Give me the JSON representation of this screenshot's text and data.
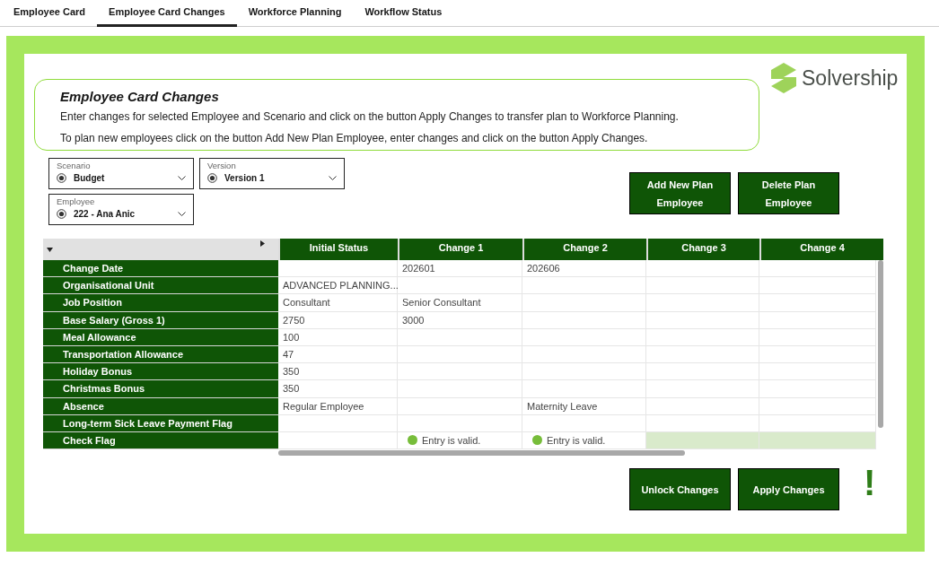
{
  "tabs": [
    {
      "label": "Employee Card",
      "selected": false
    },
    {
      "label": "Employee Card Changes",
      "selected": true
    },
    {
      "label": "Workforce Planning",
      "selected": false
    },
    {
      "label": "Workflow Status",
      "selected": false
    }
  ],
  "logo": {
    "name": "Solvership"
  },
  "intro": {
    "title": "Employee Card Changes",
    "lines": [
      "Enter changes for selected Employee and Scenario and click on the button Apply Changes to transfer plan to Workforce Planning.",
      "To plan new employees click on the button Add New Plan Employee, enter changes and click on the button Apply Changes."
    ]
  },
  "selectors": [
    {
      "label": "Scenario",
      "value": "Budget"
    },
    {
      "label": "Version",
      "value": "Version 1"
    },
    {
      "label": "Employee",
      "value": "222 - Ana Anic"
    }
  ],
  "top_buttons": [
    "Add New Plan Employee",
    "Delete Plan Employee"
  ],
  "table": {
    "columns": [
      "Initial Status",
      "Change 1",
      "Change 2",
      "Change 3",
      "Change 4"
    ],
    "rows": [
      {
        "label": "Change Date",
        "cells": [
          null,
          "202601",
          "202606",
          null,
          null
        ]
      },
      {
        "label": "Organisational Unit",
        "cells": [
          "ADVANCED PLANNING...",
          null,
          null,
          null,
          null
        ]
      },
      {
        "label": "Job Position",
        "cells": [
          "Consultant",
          "Senior Consultant",
          null,
          null,
          null
        ]
      },
      {
        "label": "Base Salary (Gross 1)",
        "cells": [
          "2750",
          "3000",
          null,
          null,
          null
        ]
      },
      {
        "label": "Meal Allowance",
        "cells": [
          "100",
          null,
          null,
          null,
          null
        ]
      },
      {
        "label": "Transportation Allowance",
        "cells": [
          "47",
          null,
          null,
          null,
          null
        ]
      },
      {
        "label": "Holiday Bonus",
        "cells": [
          "350",
          null,
          null,
          null,
          null
        ]
      },
      {
        "label": "Christmas Bonus",
        "cells": [
          "350",
          null,
          null,
          null,
          null
        ]
      },
      {
        "label": "Absence",
        "cells": [
          "Regular Employee",
          null,
          "Maternity Leave",
          null,
          null
        ]
      },
      {
        "label": "Long-term Sick Leave Payment Flag",
        "cells": [
          null,
          null,
          null,
          null,
          null
        ]
      },
      {
        "label": "Check Flag",
        "kind": "check",
        "cells": [
          {},
          {
            "text": "Entry is valid.",
            "valid": true
          },
          {
            "text": "Entry is valid.",
            "valid": true
          },
          {
            "highlighted": true
          },
          {
            "highlighted": true
          }
        ]
      }
    ]
  },
  "bottom_buttons": [
    "Unlock Changes",
    "Apply Changes"
  ],
  "alert": {
    "text": "!"
  }
}
